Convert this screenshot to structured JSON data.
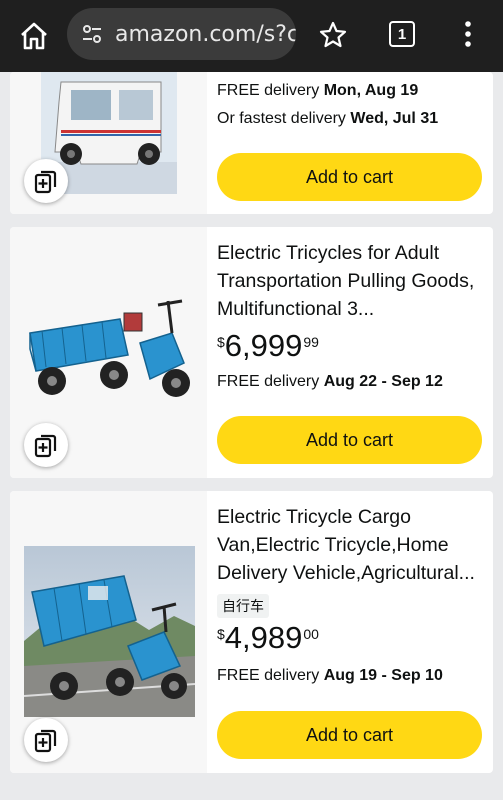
{
  "browser": {
    "url": "amazon.com/s?cr",
    "tab_count": "1",
    "icons": [
      "home-icon",
      "site-settings-icon",
      "star-icon",
      "tabs-icon",
      "more-vert-icon"
    ]
  },
  "products": [
    {
      "delivery_line1_prefix": "FREE delivery ",
      "delivery_line1_bold": "Mon, Aug 19",
      "delivery_line2_prefix": "Or fastest delivery ",
      "delivery_line2_bold": "Wed, Jul 31",
      "cart_label": "Add to cart"
    },
    {
      "title": "Electric Tricycles for Adult Transportation Pulling Goods, Multifunctional 3...",
      "price_symbol": "$",
      "price_whole": "6,999",
      "price_fraction": "99",
      "delivery_prefix": "FREE delivery ",
      "delivery_bold": "Aug 22 - Sep 12",
      "cart_label": "Add to cart"
    },
    {
      "title": "Electric Tricycle Cargo Van,Electric Tricycle,Home Delivery Vehicle,Agricultural...",
      "tag": "自行车",
      "price_symbol": "$",
      "price_whole": "4,989",
      "price_fraction": "00",
      "delivery_prefix": "FREE delivery ",
      "delivery_bold": "Aug 19 - Sep 10",
      "cart_label": "Add to cart"
    }
  ],
  "colors": {
    "topbar": "#1f1f1f",
    "cart_button": "#ffd814",
    "page_bg": "#e9eaec",
    "vehicle_blue": "#2a93cf"
  }
}
